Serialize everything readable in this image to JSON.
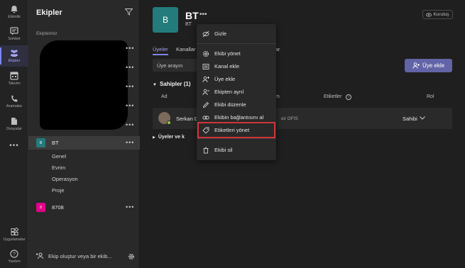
{
  "rail": {
    "items": [
      {
        "label": "Etkinlik",
        "icon": "bell-icon"
      },
      {
        "label": "Sohbet",
        "icon": "chat-icon"
      },
      {
        "label": "Ekipler",
        "icon": "teams-icon",
        "active": true
      },
      {
        "label": "Takvim",
        "icon": "calendar-icon"
      },
      {
        "label": "Aramalar",
        "icon": "phone-icon"
      },
      {
        "label": "Dosyalar",
        "icon": "files-icon"
      },
      {
        "label": "",
        "icon": "more-icon"
      }
    ],
    "apps_label": "Uygulamalar",
    "help_label": "Yardım"
  },
  "teams_pane": {
    "title": "Ekipler",
    "section": "Ekipleriniz",
    "selected_team": {
      "name": "BT",
      "avatar_text": "B",
      "avatar_color": "#237b7c"
    },
    "channels": [
      "Genel",
      "Evrim",
      "Operasyon",
      "Proje"
    ],
    "other_team": {
      "name": "8708",
      "avatar_text": "8",
      "avatar_color": "#e3008c"
    },
    "create_label": "Ekip oluştur veya bir ekib..."
  },
  "main": {
    "team_avatar": "B",
    "team_title": "BT",
    "team_sub": "BT",
    "org_label": "Kuruluş",
    "tabs": [
      "Üyeler",
      "Kanallar",
      "lar"
    ],
    "search_placeholder": "Üye arayın",
    "add_member_label": "Üye ekle",
    "owners_section": "Sahipler (1)",
    "columns": {
      "name": "Ad",
      "title": "m",
      "tags": "Etiketler",
      "role": "Rol"
    },
    "member": {
      "name": "Serkan D",
      "location": "ez OFIS",
      "role": "Sahibi"
    },
    "members_section": "Üyeler ve k"
  },
  "menu": {
    "items": [
      {
        "label": "Gizle",
        "icon": "hide-icon"
      },
      {
        "label": "Ekibi yönet",
        "icon": "gear-icon"
      },
      {
        "label": "Kanal ekle",
        "icon": "add-channel-icon"
      },
      {
        "label": "Üye ekle",
        "icon": "add-user-icon"
      },
      {
        "label": "Ekipten ayrıl",
        "icon": "leave-icon"
      },
      {
        "label": "Ekibi düzenle",
        "icon": "pencil-icon"
      },
      {
        "label": "Ekibin bağlantısını al",
        "icon": "link-icon"
      },
      {
        "label": "Etiketleri yönet",
        "icon": "tag-icon"
      },
      {
        "label": "Ekibi sil",
        "icon": "trash-icon"
      }
    ]
  }
}
